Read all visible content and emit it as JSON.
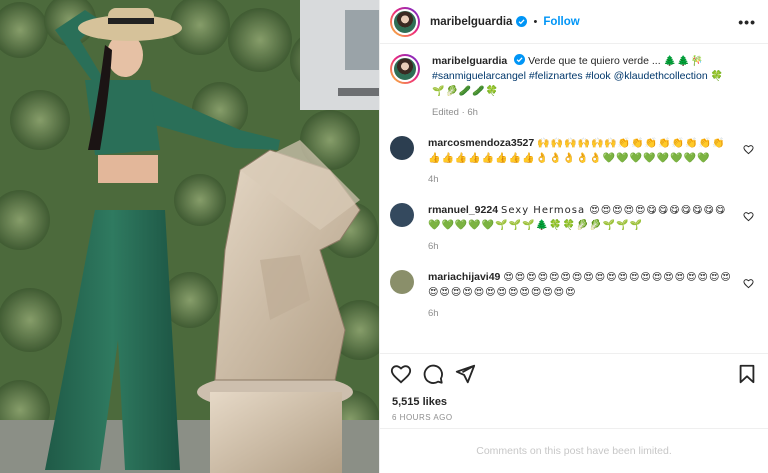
{
  "post": {
    "author": "maribelguardia",
    "follow_label": "Follow",
    "more_label": "•••"
  },
  "caption": {
    "username": "maribelguardia",
    "text": "Verde que te quiero verde ... ",
    "emojis_line1": "🌲🌲🎋",
    "hashtags": [
      "#sanmiguelarcangel",
      "#feliznartes",
      "#look"
    ],
    "mention": "@klaudethcollection",
    "emojis_line2": "🍀",
    "emojis_line3": "🌱🥬🥒🥒🍀",
    "meta": "Edited · 6h"
  },
  "comments": [
    {
      "username": "marcosmendoza3527",
      "text": "🙌🙌🙌🙌🙌🙌👏👏👏👏👏👏👏👏👍👍👍👍👍👍👍👍👌👌👌👌👌💚💚💚💚💚💚💚💚",
      "time": "4h",
      "avatar_color": "#2c3e50"
    },
    {
      "username": "rmanuel_9224",
      "text": "Sexy Hermosa 😍😍😍😍😍😋😋😋😋😋😋😋💚💚💚💚💚🌱🌱🌱🌲🍀🍀🥬🥬🌱🌱🌱",
      "time": "6h",
      "avatar_color": "#34495e"
    },
    {
      "username": "mariachijavi49",
      "text": "😍😍😍😍😍😍😍😍😍😍😍😍😍😍😍😍😍😍😍😍😍😍😍😍😍😍😍😍😍😍😍😍😍",
      "time": "6h",
      "avatar_color": "#8a8f6a"
    }
  ],
  "likes": "5,515 likes",
  "time_ago": "6 HOURS AGO",
  "limited_notice": "Comments on this post have been limited.",
  "colors": {
    "link": "#0095f6",
    "hashtag": "#00376b",
    "muted": "#8e8e8e",
    "border": "#efefef"
  }
}
